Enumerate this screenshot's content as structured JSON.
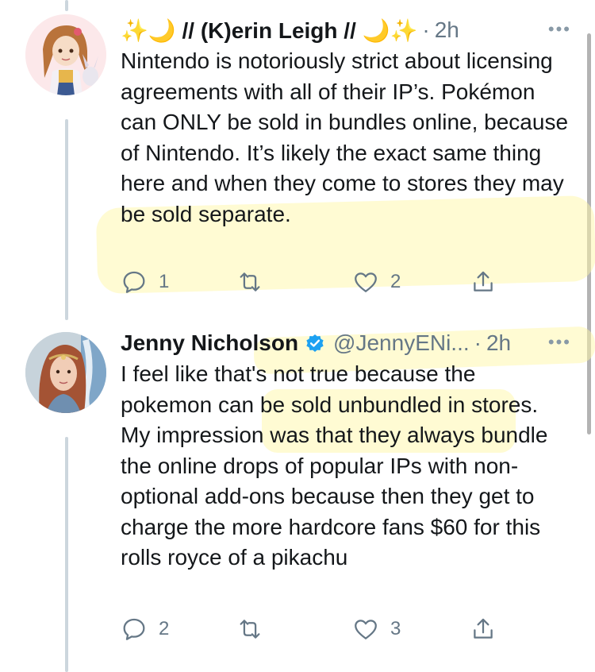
{
  "tweets": [
    {
      "display_name": "✨🌙 // (K)erin Leigh // 🌙✨",
      "handle": "",
      "separator": "·",
      "time": "2h",
      "more": "•••",
      "verified": false,
      "text": "Nintendo is notoriously strict about licensing agreements with all of their IP’s. Pokémon can ONLY be sold in bundles online, because of Nintendo. It’s likely the exact same thing here and when they come to stores they may be sold separate.",
      "actions": {
        "reply_count": "1",
        "retweet_count": "",
        "like_count": "2"
      }
    },
    {
      "display_name": "Jenny Nicholson",
      "handle": "@JennyENi...",
      "separator": "·",
      "time": "2h",
      "more": "•••",
      "verified": true,
      "text": "I feel like that's not true because the pokemon can be sold unbundled in stores. My impression was that they always bundle the online drops of popular IPs with non-optional add-ons because then they get to charge the more hardcore fans $60 for this rolls royce of a pikachu",
      "actions": {
        "reply_count": "2",
        "retweet_count": "",
        "like_count": "3"
      }
    }
  ],
  "icons": {
    "reply": "reply-icon",
    "retweet": "retweet-icon",
    "like": "heart-icon",
    "share": "share-icon",
    "more": "more-icon",
    "verified": "verified-badge-icon"
  },
  "colors": {
    "text": "#14171a",
    "secondary": "#657786",
    "thread_line": "#ccd6dd",
    "verified": "#1da1f2",
    "highlight": "#fff7a8"
  }
}
